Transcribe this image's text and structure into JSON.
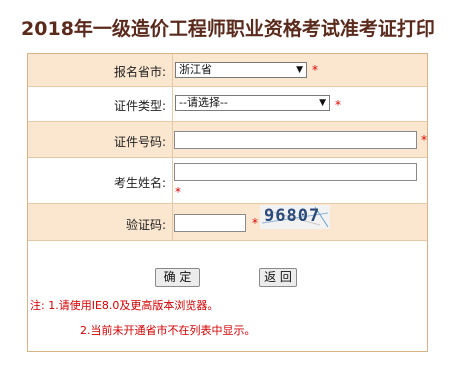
{
  "title": "2018年一级造价工程师职业资格考试准考证打印",
  "form": {
    "province": {
      "label": "报名省市:",
      "value": "浙江省",
      "required": "*"
    },
    "id_type": {
      "label": "证件类型:",
      "value": "--请选择--",
      "required": "*"
    },
    "id_number": {
      "label": "证件号码:",
      "value": "",
      "required": "*"
    },
    "name": {
      "label": "考生姓名:",
      "value": "",
      "required": "*"
    },
    "captcha": {
      "label": "验证码:",
      "value": "",
      "required": "*",
      "image_text": "96807"
    }
  },
  "buttons": {
    "confirm": "确 定",
    "back": "返 回"
  },
  "notes": {
    "line1": "注: 1.请使用IE8.0及更高版本浏览器。",
    "line2": "2.当前未开通省市不在列表中显示。"
  },
  "colors": {
    "row_shade": "#fbe6cf",
    "border": "#d9b48a",
    "required": "#e00000",
    "title": "#5a2a1c"
  }
}
